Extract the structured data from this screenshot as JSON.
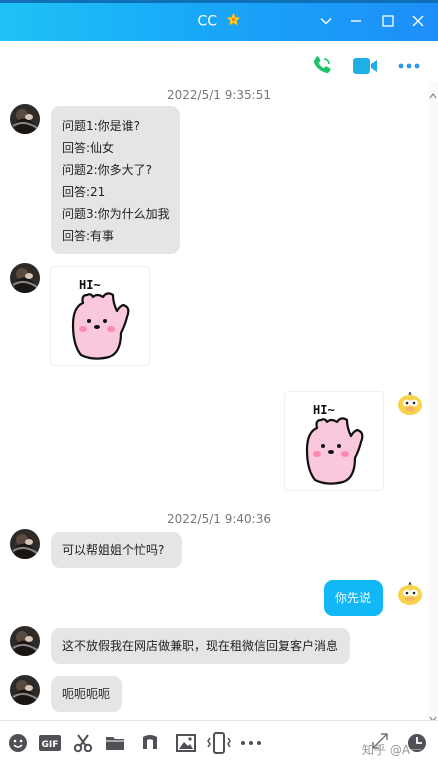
{
  "window": {
    "title": "CC"
  },
  "toolbar": {
    "items": [
      "phone-call-icon",
      "video-call-icon",
      "more-dots-icon"
    ]
  },
  "chat": {
    "messages": [
      {
        "type": "timestamp",
        "text": "2022/5/1 9:35:51"
      },
      {
        "type": "text",
        "side": "left",
        "lines": [
          "问题1:你是谁?",
          "回答:仙女",
          "问题2:你多大了?",
          "回答:21",
          "问题3:你为什么加我",
          "回答:有事"
        ]
      },
      {
        "type": "sticker",
        "side": "left",
        "text": "HI~"
      },
      {
        "type": "sticker",
        "side": "right",
        "text": "HI~"
      },
      {
        "type": "timestamp",
        "text": "2022/5/1 9:40:36"
      },
      {
        "type": "text",
        "side": "left",
        "lines": [
          "可以帮姐姐个忙吗?"
        ]
      },
      {
        "type": "text",
        "side": "right",
        "lines": [
          "你先说"
        ]
      },
      {
        "type": "text",
        "side": "left",
        "lines": [
          "这不放假我在网店做兼职，现在租微信回复客户消息"
        ]
      },
      {
        "type": "text",
        "side": "left",
        "lines": [
          "呃呃呃呃"
        ]
      }
    ]
  },
  "bottom_toolbar": {
    "items": [
      "emoji-icon",
      "gif-icon",
      "scissors-icon",
      "folder-icon",
      "music-note-icon",
      "image-icon",
      "phone-shake-icon",
      "more-dots-icon",
      "expand-icon",
      "clock-history-icon"
    ],
    "gif_label": "GIF",
    "watermark": "知乎 @A一"
  },
  "colors": {
    "titlebar": "#1ea6f7",
    "accent": "#12b7f5",
    "bubble_left": "#e5e5e5",
    "call_green": "#1fc36c",
    "video_teal": "#1dafe6"
  }
}
